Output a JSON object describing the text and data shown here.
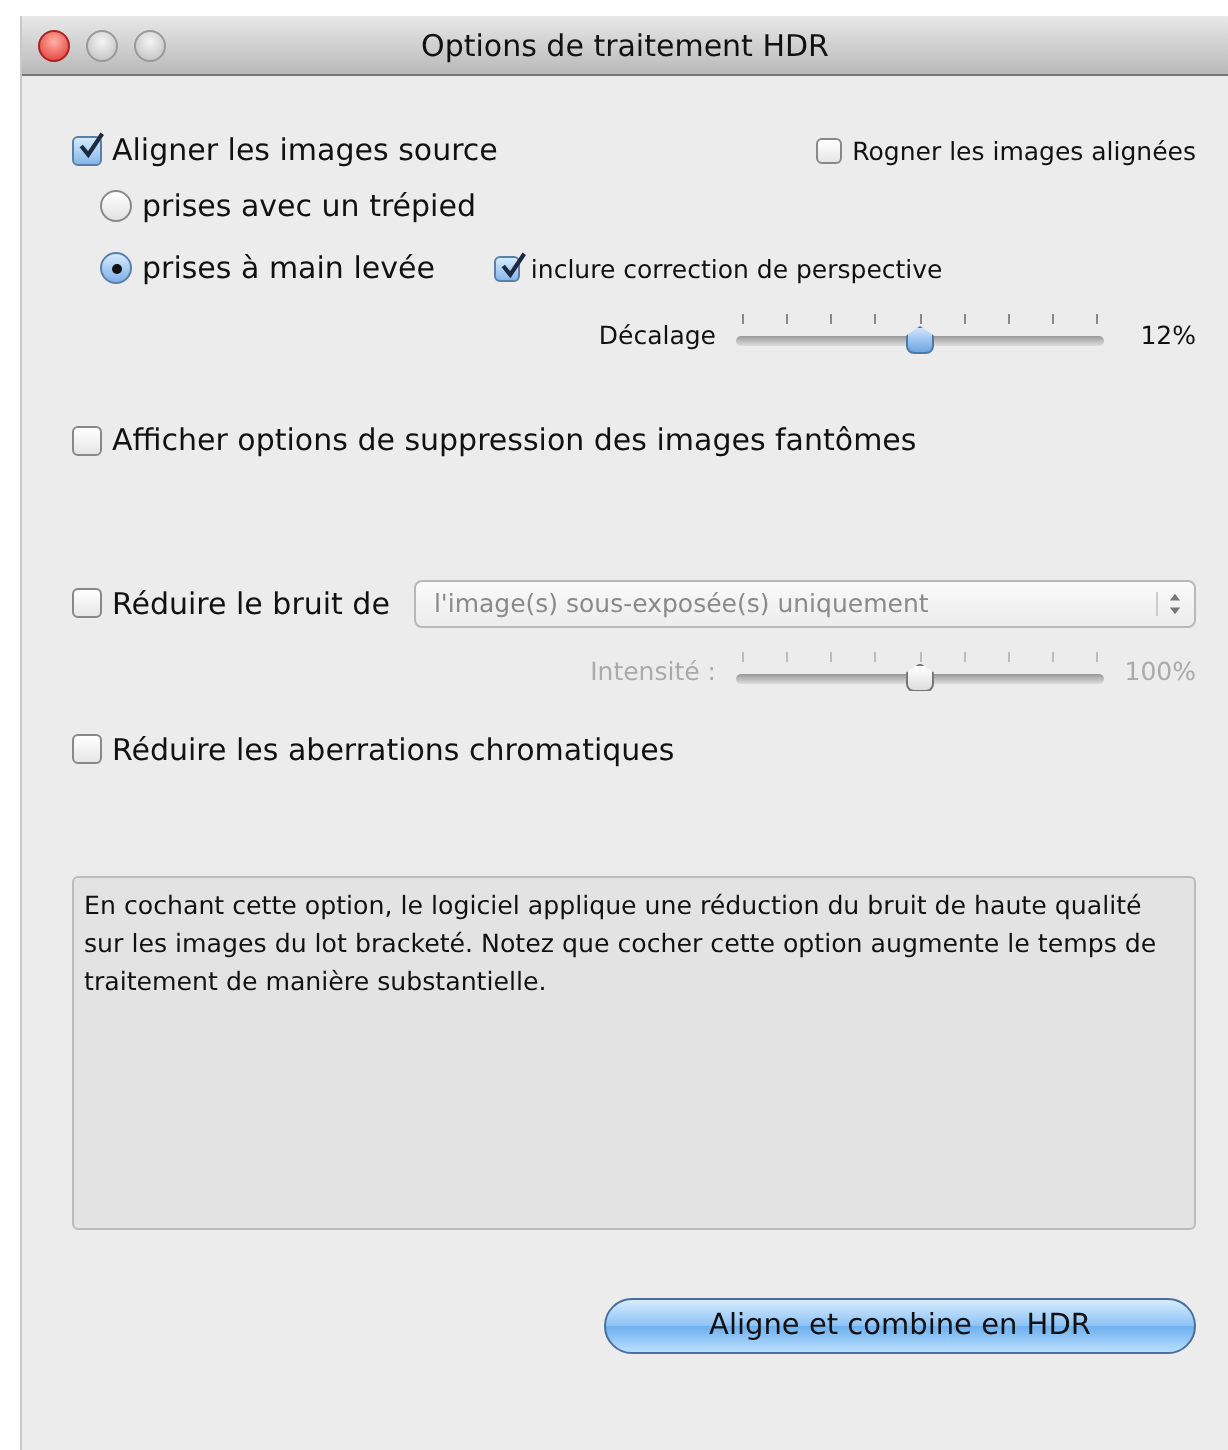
{
  "window": {
    "title": "Options de traitement HDR"
  },
  "align": {
    "label": "Aligner les images source",
    "checked": true
  },
  "crop": {
    "label": "Rogner les images alignées",
    "checked": false
  },
  "capture_modes": [
    {
      "label": "prises avec un trépied",
      "selected": false
    },
    {
      "label": "prises à main levée",
      "selected": true
    }
  ],
  "perspective": {
    "label": "inclure correction de perspective",
    "checked": true
  },
  "offset_slider": {
    "label": "Décalage",
    "level": 0.5,
    "reading": "12%",
    "disabled": false
  },
  "ghost": {
    "label": "Afficher options de suppression des images fantômes",
    "checked": false
  },
  "noise": {
    "label": "Réduire le bruit de",
    "checked": false
  },
  "noise_dropdown": {
    "value": "l'image(s) sous-exposée(s) uniquement",
    "disabled": true
  },
  "intensity_slider": {
    "label": "Intensité :",
    "level": 0.5,
    "reading": "100%",
    "disabled": true
  },
  "chromatic": {
    "label": "Réduire les aberrations chromatiques",
    "checked": false
  },
  "description": "En cochant cette option, le logiciel applique une réduction du bruit de haute qualité sur les images du lot bracketé. Notez que cocher cette option augmente le temps de traitement de manière substantielle.",
  "buttons": [
    {
      "label": "Aligne et combine en HDR"
    }
  ]
}
